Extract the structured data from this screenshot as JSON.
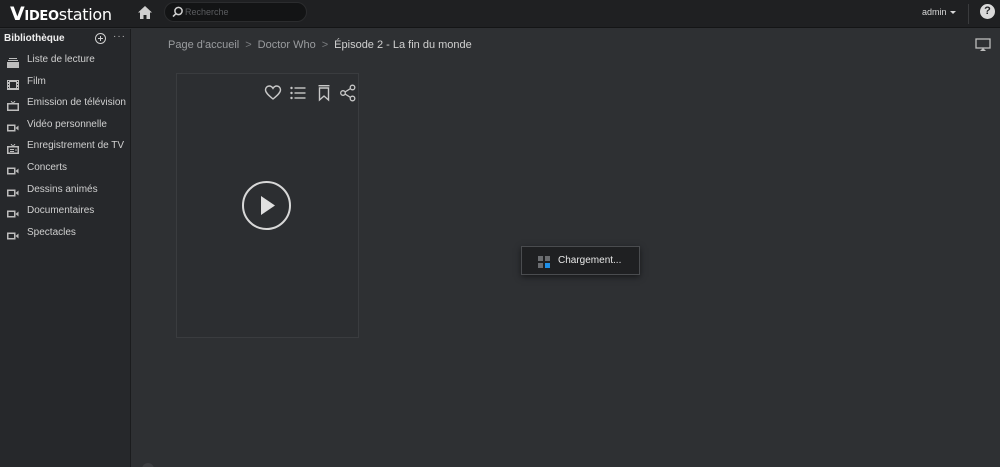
{
  "app": {
    "logo_main": "V",
    "logo_bold": "IDEO",
    "logo_light": "station"
  },
  "topbar": {
    "search_placeholder": "Recherche",
    "user_label": "admin",
    "help_label": "?"
  },
  "sidebar": {
    "title": "Bibliothèque",
    "more_label": "···",
    "items": [
      {
        "label": "Liste de lecture",
        "icon": "playlist-icon"
      },
      {
        "label": "Film",
        "icon": "film-icon"
      },
      {
        "label": "Émission de télévision",
        "icon": "tv-icon"
      },
      {
        "label": "Vidéo personnelle",
        "icon": "video-camera-icon"
      },
      {
        "label": "Enregistrement de TV",
        "icon": "tv-recording-icon"
      },
      {
        "label": "Concerts",
        "icon": "video-camera-icon"
      },
      {
        "label": "Dessins animés",
        "icon": "video-camera-icon"
      },
      {
        "label": "Documentaires",
        "icon": "video-camera-icon"
      },
      {
        "label": "Spectacles",
        "icon": "video-camera-icon"
      }
    ]
  },
  "breadcrumb": {
    "items": [
      "Page d'accueil",
      "Doctor Who",
      "Épisode 2 - La fin du monde"
    ],
    "separator": ">"
  },
  "loading": {
    "text": "Chargement..."
  },
  "colors": {
    "background": "#2e3033",
    "topbar": "#1f2022",
    "sidebar": "#26282b",
    "accent_blue": "#1e8fe8"
  }
}
